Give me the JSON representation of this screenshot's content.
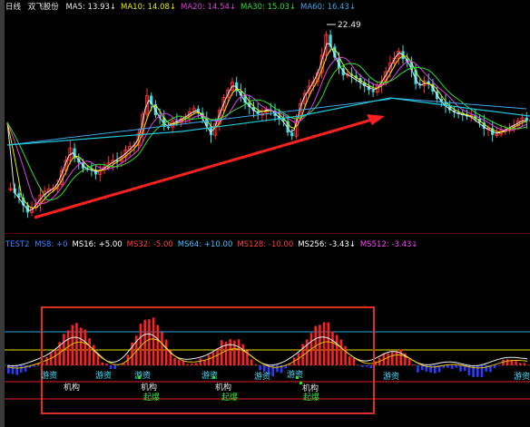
{
  "header": {
    "period": "日线",
    "stock": "双飞股份",
    "ma": [
      {
        "label": "MA5",
        "value": "13.93↓",
        "color": "#e8e8e8"
      },
      {
        "label": "MA10",
        "value": "14.08↓",
        "color": "#e8e800"
      },
      {
        "label": "MA20",
        "value": "14.54↓",
        "color": "#e040e0"
      },
      {
        "label": "MA30",
        "value": "15.03↓",
        "color": "#30e030"
      },
      {
        "label": "MA60",
        "value": "16.43↓",
        "color": "#40a8e8"
      }
    ]
  },
  "indicator": {
    "name": "TEST2",
    "items": [
      {
        "label": "MS8",
        "value": "+0",
        "color": "#4080ff"
      },
      {
        "label": "MS16",
        "value": "+5.00",
        "color": "#ffffff"
      },
      {
        "label": "MS32",
        "value": "-5.00",
        "color": "#ff4040"
      },
      {
        "label": "MS64",
        "value": "+10.00",
        "color": "#40c0ff"
      },
      {
        "label": "MS128",
        "value": "-10.00",
        "color": "#ff4040"
      },
      {
        "label": "MS256",
        "value": "-3.43↓",
        "color": "#ffffff"
      },
      {
        "label": "MS512",
        "value": "-3.43↓",
        "color": "#ff40ff"
      }
    ],
    "labels": {
      "youzi": "游资",
      "jigou": "机构",
      "qibao": "起爆"
    }
  },
  "annotations": {
    "high_price": "22.49"
  },
  "colors": {
    "up": "#ff3030",
    "down": "#40e0e0",
    "arrow": "#ff2020",
    "hist_pos": "#ff2020",
    "hist_neg": "#2a3cff",
    "box": "#e03020"
  },
  "chart_data": [
    {
      "type": "candlestick",
      "title": "",
      "price_high": 22.49,
      "candle_count": 120,
      "trend": "rising from low-left to high around the 22.49 peak, then declining",
      "moving_averages": [
        "MA5",
        "MA10",
        "MA20",
        "MA30",
        "MA60"
      ]
    },
    {
      "type": "bar",
      "title": "TEST2",
      "series": [
        {
          "name": "MS8",
          "values": [
            0
          ]
        },
        {
          "name": "MS16",
          "values": [
            5.0
          ]
        },
        {
          "name": "MS32",
          "values": [
            -5.0
          ]
        },
        {
          "name": "MS64",
          "values": [
            10.0
          ]
        },
        {
          "name": "MS128",
          "values": [
            -10.0
          ]
        },
        {
          "name": "MS256",
          "values": [
            -3.43
          ]
        },
        {
          "name": "MS512",
          "values": [
            -3.43
          ]
        }
      ]
    }
  ]
}
